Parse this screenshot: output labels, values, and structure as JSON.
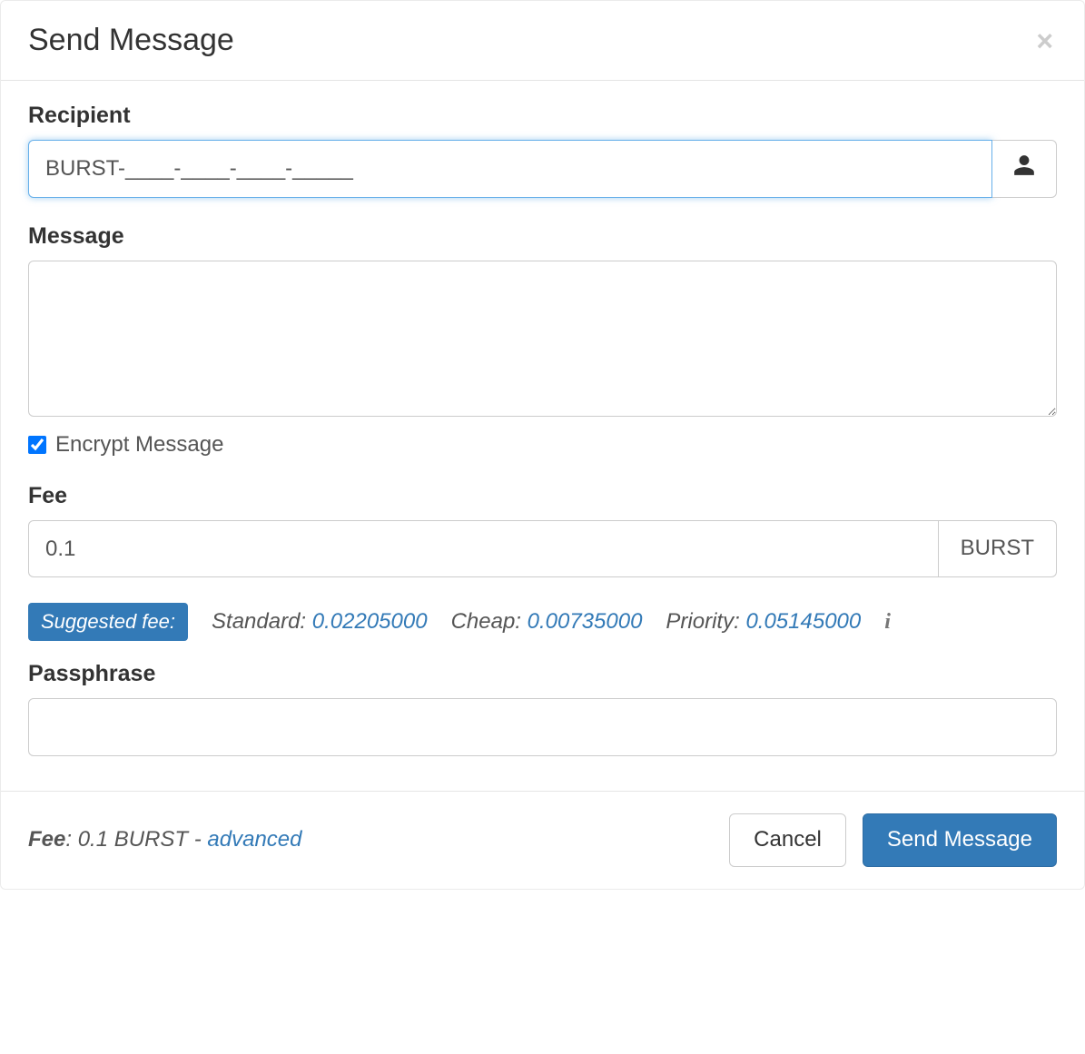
{
  "header": {
    "title": "Send Message"
  },
  "form": {
    "recipient": {
      "label": "Recipient",
      "value": "BURST-____-____-____-_____"
    },
    "message": {
      "label": "Message",
      "value": "",
      "encrypt_label": "Encrypt Message",
      "encrypt_checked": true
    },
    "fee": {
      "label": "Fee",
      "value": "0.1",
      "unit": "BURST"
    },
    "suggested": {
      "badge": "Suggested fee:",
      "standard_label": "Standard:",
      "standard_value": "0.02205000",
      "cheap_label": "Cheap:",
      "cheap_value": "0.00735000",
      "priority_label": "Priority:",
      "priority_value": "0.05145000"
    },
    "passphrase": {
      "label": "Passphrase",
      "value": ""
    }
  },
  "footer": {
    "fee_word": "Fee",
    "fee_text": ": 0.1 BURST - ",
    "advanced": "advanced",
    "cancel": "Cancel",
    "submit": "Send Message"
  }
}
